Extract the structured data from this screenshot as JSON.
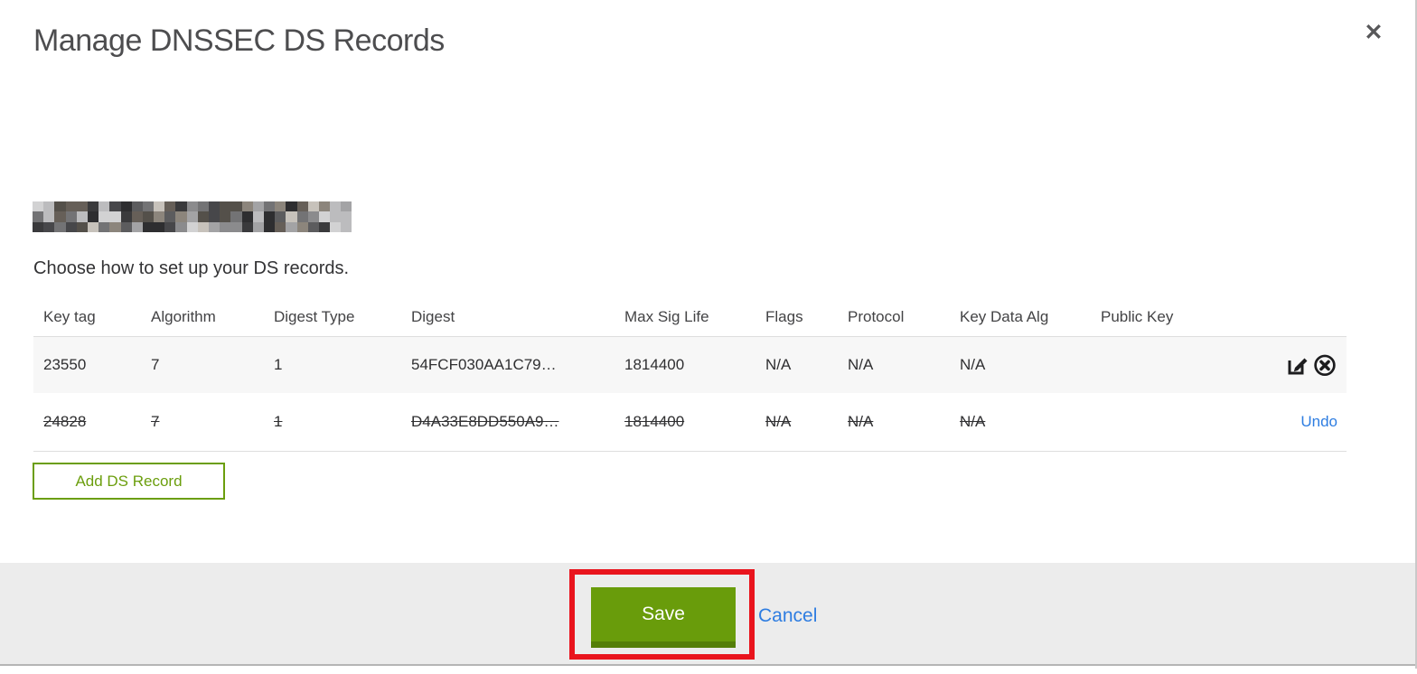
{
  "modal": {
    "title": "Manage DNSSEC DS Records",
    "close_glyph": "✕",
    "subtitle": "Choose how to set up your DS records."
  },
  "table": {
    "columns": [
      "Key tag",
      "Algorithm",
      "Digest Type",
      "Digest",
      "Max Sig Life",
      "Flags",
      "Protocol",
      "Key Data Alg",
      "Public Key"
    ],
    "rows": [
      {
        "state": "active",
        "cells": [
          "23550",
          "7",
          "1",
          "54FCF030AA1C79…",
          "1814400",
          "N/A",
          "N/A",
          "N/A",
          ""
        ],
        "actions": [
          "edit",
          "delete"
        ]
      },
      {
        "state": "deleted",
        "cells": [
          "24828",
          "7",
          "1",
          "D4A33E8DD550A9…",
          "1814400",
          "N/A",
          "N/A",
          "N/A",
          ""
        ],
        "undo_label": "Undo"
      }
    ]
  },
  "buttons": {
    "add_ds_record": "Add DS Record",
    "save": "Save",
    "cancel": "Cancel"
  },
  "icons": {
    "edit": "pencil-in-square",
    "delete": "x-in-circle",
    "close": "x-mark"
  },
  "annotation": {
    "type": "highlight-box",
    "target": "save-button",
    "color": "#e9141d"
  },
  "colors": {
    "green_accent": "#6b9e0d",
    "save_button_bg": "#699c0b",
    "save_button_shadow": "#547e08",
    "link_blue": "#2e7de1",
    "row_alt_bg": "#f7f7f7",
    "footer_bg": "#ececec",
    "annotation_red": "#e9141d"
  },
  "redaction": {
    "cols": 29,
    "rows": 3,
    "palette": [
      "#2e2e30",
      "#47474a",
      "#5c5c5e",
      "#737375",
      "#8b8b8d",
      "#a3a3a5",
      "#bcbcbe",
      "#d2d2d3",
      "#3a3a3c",
      "#665f58",
      "#8c857c",
      "#54504a",
      "#c7c2bb"
    ]
  }
}
